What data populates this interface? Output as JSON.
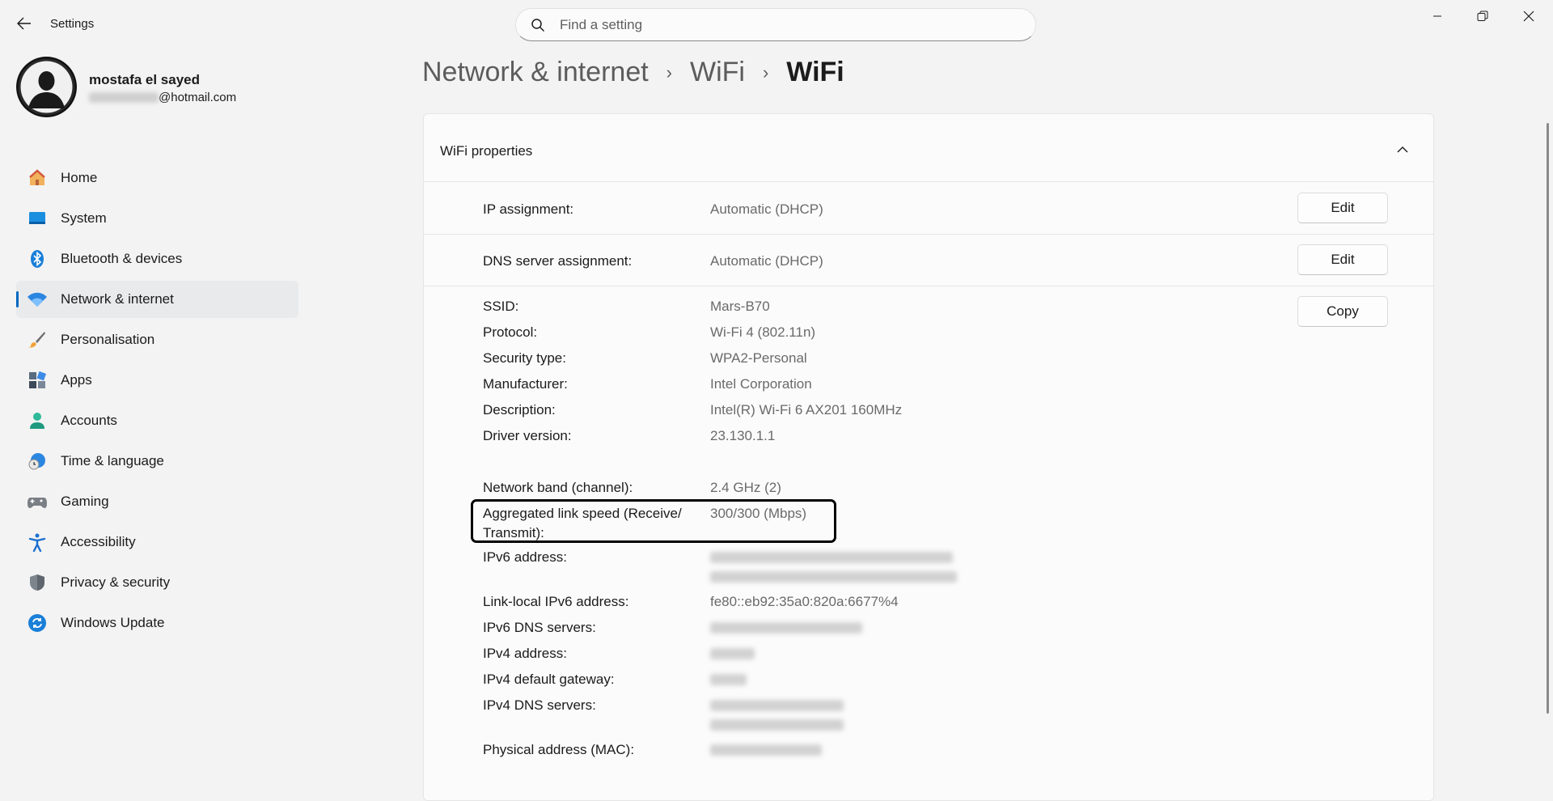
{
  "window": {
    "title": "Settings"
  },
  "search": {
    "placeholder": "Find a setting"
  },
  "profile": {
    "name": "mostafa el sayed",
    "email_domain": "@hotmail.com"
  },
  "nav": [
    {
      "label": "Home",
      "icon": "home-icon"
    },
    {
      "label": "System",
      "icon": "system-icon"
    },
    {
      "label": "Bluetooth & devices",
      "icon": "bluetooth-icon"
    },
    {
      "label": "Network & internet",
      "icon": "wifi-icon",
      "active": true
    },
    {
      "label": "Personalisation",
      "icon": "brush-icon"
    },
    {
      "label": "Apps",
      "icon": "apps-icon"
    },
    {
      "label": "Accounts",
      "icon": "accounts-icon"
    },
    {
      "label": "Time & language",
      "icon": "clock-globe-icon"
    },
    {
      "label": "Gaming",
      "icon": "gamepad-icon"
    },
    {
      "label": "Accessibility",
      "icon": "accessibility-icon"
    },
    {
      "label": "Privacy & security",
      "icon": "shield-icon"
    },
    {
      "label": "Windows Update",
      "icon": "update-icon"
    }
  ],
  "breadcrumb": {
    "part1": "Network & internet",
    "part2": "WiFi",
    "current": "WiFi"
  },
  "panel": {
    "title": "WiFi properties",
    "ip_assignment": {
      "label": "IP assignment:",
      "value": "Automatic (DHCP)",
      "button": "Edit"
    },
    "dns_assignment": {
      "label": "DNS server assignment:",
      "value": "Automatic (DHCP)",
      "button": "Edit"
    },
    "copy_button": "Copy",
    "properties": {
      "ssid": {
        "label": "SSID:",
        "value": "Mars-B70"
      },
      "protocol": {
        "label": "Protocol:",
        "value": "Wi-Fi 4 (802.11n)"
      },
      "security": {
        "label": "Security type:",
        "value": "WPA2-Personal"
      },
      "manufacturer": {
        "label": "Manufacturer:",
        "value": "Intel Corporation"
      },
      "description": {
        "label": "Description:",
        "value": "Intel(R) Wi-Fi 6 AX201 160MHz"
      },
      "driver": {
        "label": "Driver version:",
        "value": "23.130.1.1"
      },
      "band": {
        "label": "Network band (channel):",
        "value": "2.4 GHz (2)"
      },
      "link_speed": {
        "label_line1": "Aggregated link speed (Receive/",
        "label_line2": "Transmit):",
        "value": "300/300 (Mbps)"
      },
      "ipv6": {
        "label": "IPv6 address:"
      },
      "link_local": {
        "label": "Link-local IPv6 address:",
        "value": "fe80::eb92:35a0:820a:6677%4"
      },
      "ipv6_dns": {
        "label": "IPv6 DNS servers:"
      },
      "ipv4": {
        "label": "IPv4 address:"
      },
      "ipv4_gateway": {
        "label": "IPv4 default gateway:"
      },
      "ipv4_dns": {
        "label": "IPv4 DNS servers:"
      },
      "mac": {
        "label": "Physical address (MAC):"
      }
    }
  },
  "colors": {
    "accent": "#0067c0",
    "background": "#f3f3f3",
    "card": "#fbfbfb"
  }
}
